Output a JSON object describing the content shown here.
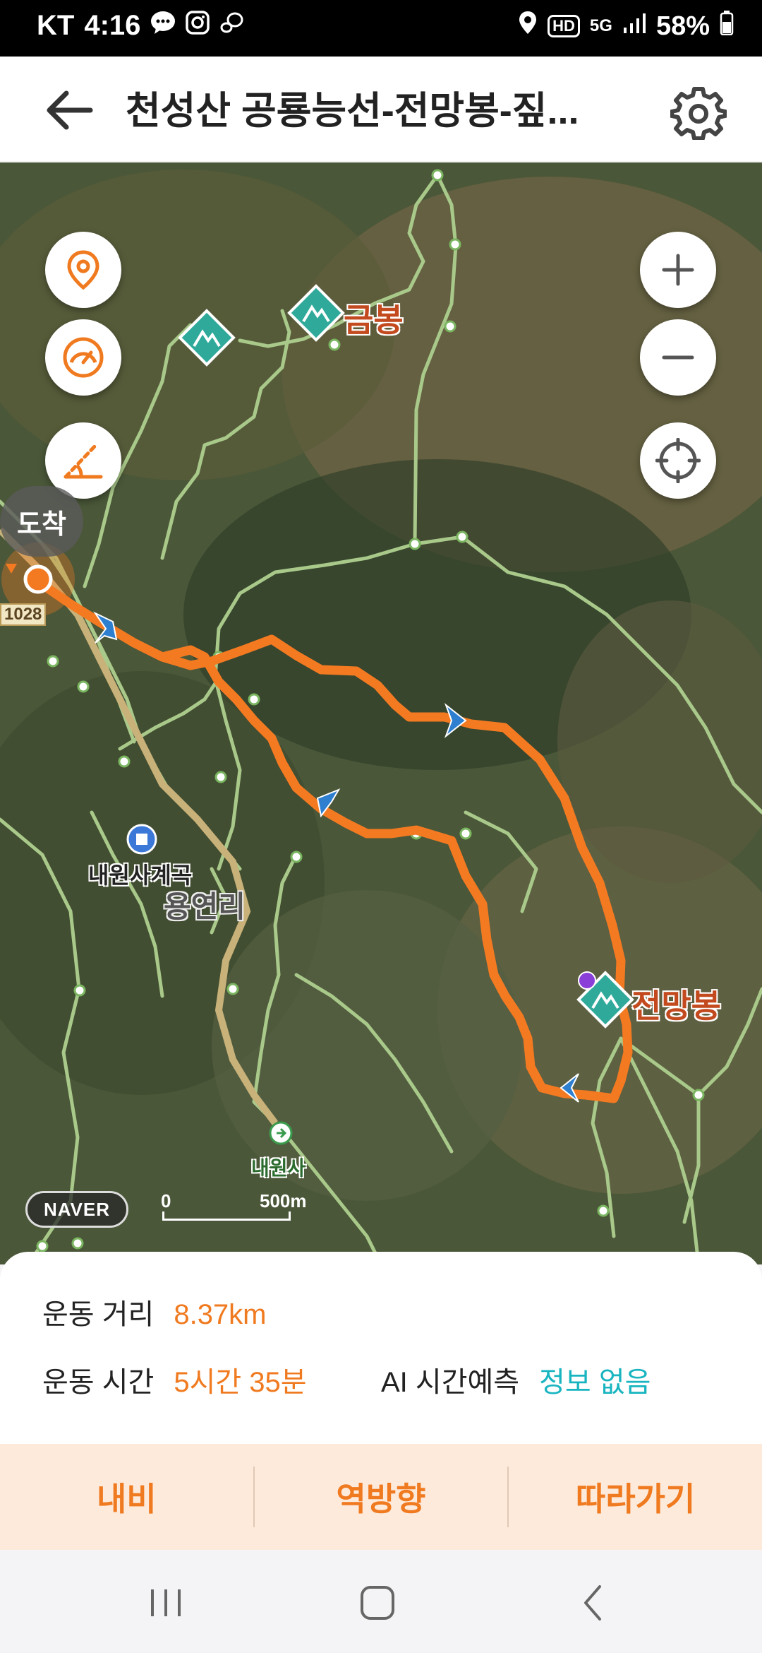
{
  "status_bar": {
    "carrier": "KT",
    "time": "4:16",
    "hd": "HD",
    "network": "5G",
    "battery": "58%"
  },
  "header": {
    "title": "천성산 공룡능선-전망봉-짚..."
  },
  "map": {
    "arrival_label": "도착",
    "road_number": "1028",
    "places": {
      "geumbong": "금봉",
      "jeonmangbong": "전망봉",
      "valley": "내원사계곡",
      "village": "용연리",
      "temple": "내원사"
    },
    "logo": "NAVER",
    "scale_start": "0",
    "scale_end": "500m",
    "route_color": "#f47a22",
    "trail_color": "#a9c98a"
  },
  "stats": {
    "distance_label": "운동 거리",
    "distance_value": "8.37km",
    "time_label": "운동 시간",
    "time_value": "5시간 35분",
    "ai_label": "AI 시간예측",
    "ai_value": "정보 없음"
  },
  "actions": {
    "navi": "내비",
    "reverse": "역방향",
    "follow": "따라가기"
  },
  "colors": {
    "accent": "#f07a1f",
    "teal": "#18b5c0",
    "action_bg": "#fdeadb"
  }
}
